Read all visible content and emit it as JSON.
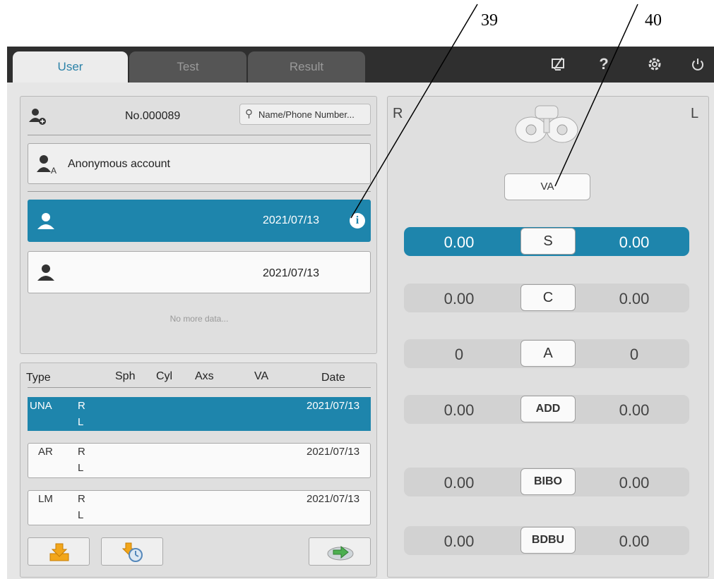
{
  "callouts": [
    "39",
    "40"
  ],
  "tabs": [
    {
      "label": "User",
      "active": true
    },
    {
      "label": "Test",
      "active": false
    },
    {
      "label": "Result",
      "active": false
    }
  ],
  "top_icons": [
    "screen-off-icon",
    "help-icon",
    "settings-icon",
    "power-icon"
  ],
  "user_panel": {
    "number": "No.000089",
    "search_placeholder": "Name/Phone Number...",
    "anonymous_label": "Anonymous account",
    "users": [
      {
        "date": "2021/07/13",
        "selected": true
      },
      {
        "date": "2021/07/13",
        "selected": false
      }
    ],
    "no_more": "No more data..."
  },
  "history": {
    "headers": [
      "Type",
      "Sph",
      "Cyl",
      "Axs",
      "VA",
      "Date"
    ],
    "rows": [
      {
        "type": "UNA",
        "eyes": [
          "R",
          "L"
        ],
        "date": "2021/07/13",
        "selected": true
      },
      {
        "type": "AR",
        "eyes": [
          "R",
          "L"
        ],
        "date": "2021/07/13",
        "selected": false
      },
      {
        "type": "LM",
        "eyes": [
          "R",
          "L"
        ],
        "date": "2021/07/13",
        "selected": false
      }
    ],
    "buttons": [
      "import-icon",
      "history-import-icon",
      "transfer-icon"
    ]
  },
  "right_panel": {
    "right_label": "R",
    "left_label": "L",
    "va_button": "VA",
    "rows": [
      {
        "label": "S",
        "r": "0.00",
        "l": "0.00",
        "active": true
      },
      {
        "label": "C",
        "r": "0.00",
        "l": "0.00",
        "active": false
      },
      {
        "label": "A",
        "r": "0",
        "l": "0",
        "active": false
      },
      {
        "label": "ADD",
        "r": "0.00",
        "l": "0.00",
        "active": false
      },
      {
        "label": "BIBO",
        "r": "0.00",
        "l": "0.00",
        "active": false
      },
      {
        "label": "BDBU",
        "r": "0.00",
        "l": "0.00",
        "active": false
      }
    ]
  },
  "colors": {
    "accent": "#1e85ac",
    "tab_active_text": "#2b82a8",
    "topbar": "#2f2f2f"
  }
}
